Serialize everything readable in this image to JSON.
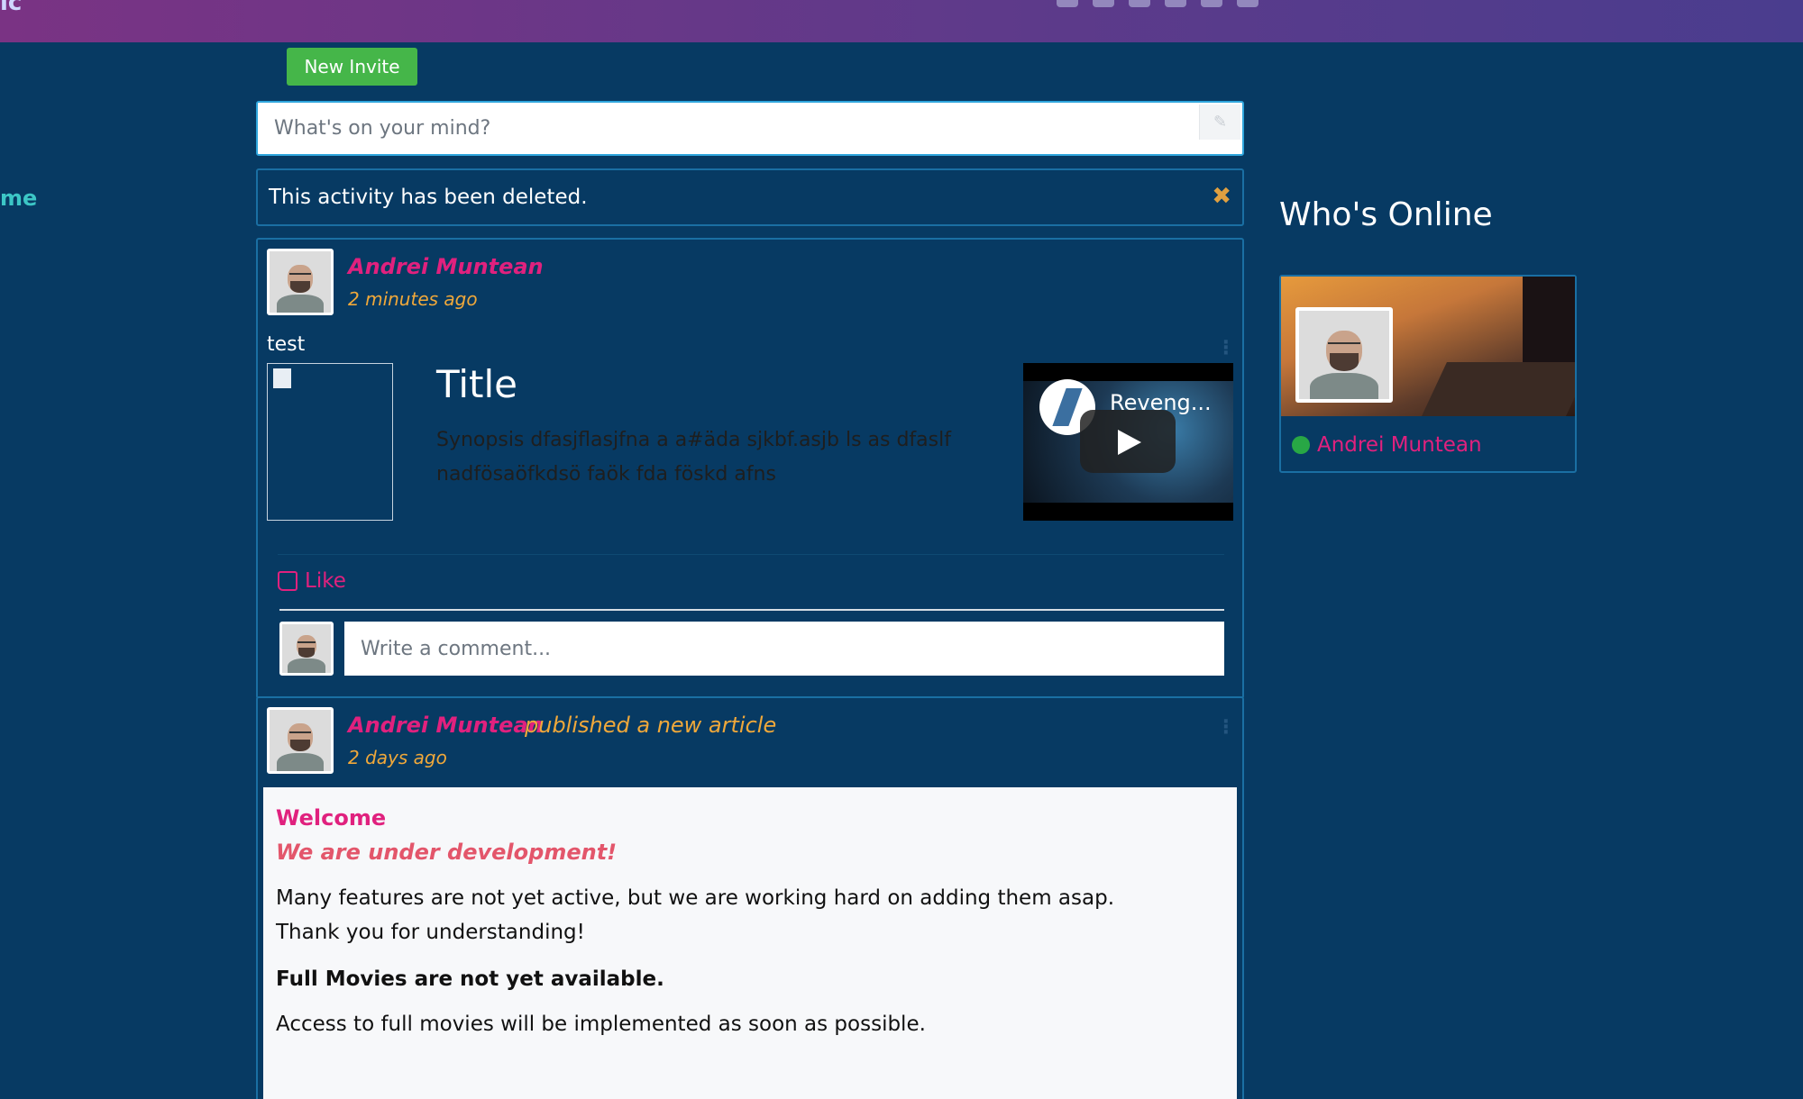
{
  "topbar": {
    "brand_fragment": "ic",
    "icons": [
      "user-icon",
      "users-icon",
      "envelope-icon",
      "user-circle-icon",
      "camera-icon",
      "tools-icon"
    ]
  },
  "sidebar": {
    "active_fragment": "me"
  },
  "toolbar": {
    "new_invite_label": "New Invite"
  },
  "status": {
    "placeholder": "What's on your mind?",
    "icon": "edit-icon"
  },
  "alert": {
    "message": "This activity has been deleted.",
    "close_icon": "close-icon"
  },
  "posts": [
    {
      "author": "Andrei Muntean",
      "time": "2 minutes ago",
      "text": "test",
      "link_preview": {
        "title": "Title",
        "synopsis": "Synopsis dfasjflasjfna a a#äda sjkbf.asjb ls as dfaslf nadfösaöfkdsö faök fda föskd afns",
        "video_title": "Reveng..."
      },
      "like_label": "Like",
      "comment_placeholder": "Write a comment..."
    },
    {
      "author": "Andrei Muntean",
      "action": "published a new article",
      "time": "2 days ago",
      "article": {
        "title": "Welcome",
        "subtitle": "We are under development!",
        "paragraph1_line1": "Many features are not yet active, but we are working hard on adding them asap.",
        "paragraph1_line2": "Thank you for understanding!",
        "bold_line": "Full Movies are not yet available.",
        "paragraph2": "Access to full movies will be implemented as soon as possible."
      }
    }
  ],
  "whos_online": {
    "title": "Who's Online",
    "users": [
      {
        "name": "Andrei Muntean",
        "status_color": "#28a745"
      }
    ]
  },
  "colors": {
    "background": "#073a63",
    "accent_pink": "#e0217e",
    "accent_orange": "#f0a83a",
    "button_green": "#45b649",
    "border_blue": "#1a6fa3"
  }
}
